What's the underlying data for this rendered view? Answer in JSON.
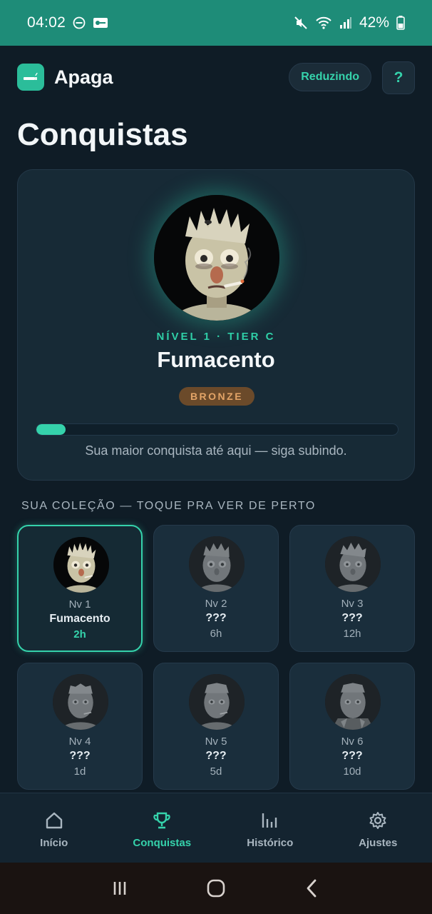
{
  "status_bar": {
    "time": "04:02",
    "battery": "42%",
    "icons_left": [
      "dnd-icon",
      "key-icon"
    ],
    "icons_right": [
      "mute-icon",
      "wifi-icon",
      "signal-icon",
      "battery-icon"
    ]
  },
  "header": {
    "app_name": "Apaga",
    "mode_label": "Reduzindo",
    "help_label": "?"
  },
  "page_title": "Conquistas",
  "hero": {
    "level_label": "NÍVEL 1 · TIER C",
    "name": "Fumacento",
    "badge": "BRONZE",
    "progress_fraction": 0.08,
    "caption": "Sua maior conquista até aqui — siga subindo."
  },
  "collection": {
    "section_label": "SUA COLEÇÃO — TOQUE PRA VER DE PERTO",
    "cards": [
      {
        "level": "Nv 1",
        "name": "Fumacento",
        "time": "2h",
        "unlocked": true
      },
      {
        "level": "Nv 2",
        "name": "???",
        "time": "6h",
        "unlocked": false
      },
      {
        "level": "Nv 3",
        "name": "???",
        "time": "12h",
        "unlocked": false
      },
      {
        "level": "Nv 4",
        "name": "???",
        "time": "1d",
        "unlocked": false
      },
      {
        "level": "Nv 5",
        "name": "???",
        "time": "5d",
        "unlocked": false
      },
      {
        "level": "Nv 6",
        "name": "???",
        "time": "10d",
        "unlocked": false
      }
    ]
  },
  "bottom_nav": {
    "items": [
      {
        "label": "Início",
        "icon": "home-icon"
      },
      {
        "label": "Conquistas",
        "icon": "trophy-icon"
      },
      {
        "label": "Histórico",
        "icon": "bar-chart-icon"
      },
      {
        "label": "Ajustes",
        "icon": "gear-icon"
      }
    ],
    "active": "Conquistas"
  },
  "colors": {
    "accent": "#35d2ab",
    "status_bar": "#1e8c78",
    "background": "#0f1c26",
    "card": "#1a2e3c",
    "bronze": "#e3a467"
  }
}
